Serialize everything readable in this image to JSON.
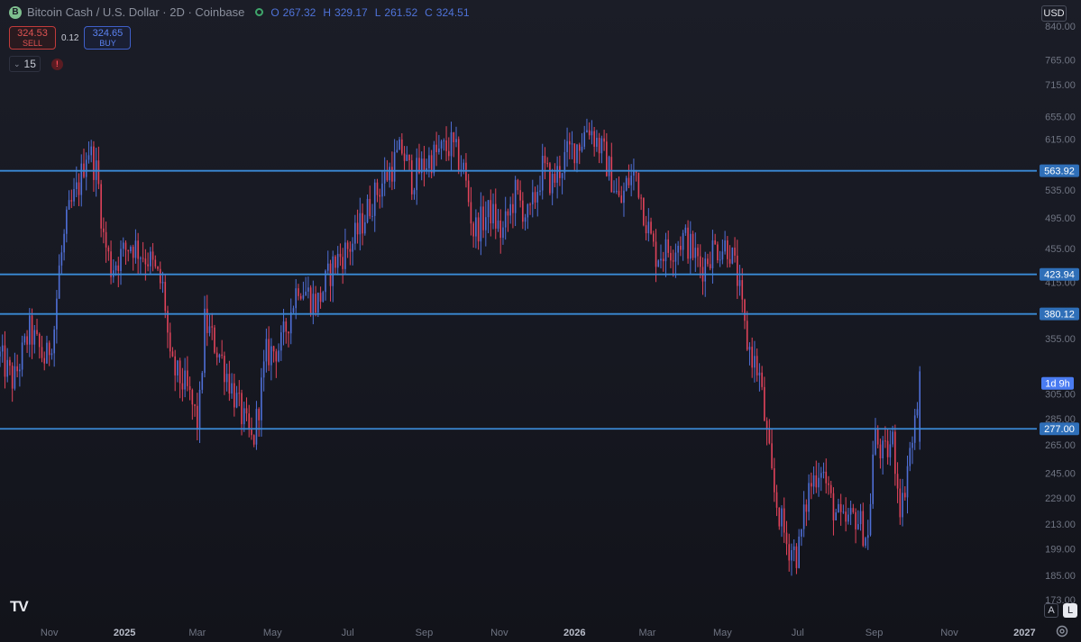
{
  "header": {
    "symbol_logo": "B",
    "title": "Bitcoin Cash / U.S. Dollar · 2D · Coinbase",
    "ohlc": [
      {
        "label": "O",
        "value": "267.32"
      },
      {
        "label": "H",
        "value": "329.17"
      },
      {
        "label": "L",
        "value": "261.52"
      },
      {
        "label": "C",
        "value": "324.51"
      }
    ]
  },
  "trade": {
    "sell_price": "324.53",
    "sell_label": "SELL",
    "spread": "0.12",
    "buy_price": "324.65",
    "buy_label": "BUY"
  },
  "indicators": {
    "count": "15",
    "alert_symbol": "!"
  },
  "currency": "USD",
  "logo_text": "TV",
  "scale_buttons": {
    "auto": "A",
    "log": "L"
  },
  "icons": {
    "settings": "gear-icon",
    "alert": "alert-icon",
    "collapse": "chevron-down-icon",
    "symbol": "bitcoin-cash-icon",
    "status": "market-status-icon"
  },
  "colors": {
    "up": "#4f6fd6",
    "down": "#e0435a",
    "level_line": "#3a8ad6",
    "level_label": "#2f6fb8",
    "countdown_label": "#4a7cf2"
  },
  "chart_data": {
    "type": "candlestick",
    "log_scale": true,
    "grid": false,
    "y_ticks": [
      840,
      765,
      715,
      655,
      615,
      535,
      495,
      455,
      415,
      355,
      305,
      285,
      265,
      245,
      229,
      213,
      199,
      185,
      173
    ],
    "x_ticks": [
      {
        "label": "Nov",
        "date": "2024-11-01"
      },
      {
        "label": "2025",
        "date": "2025-01-01"
      },
      {
        "label": "Mar",
        "date": "2025-03-01"
      },
      {
        "label": "May",
        "date": "2025-05-01"
      },
      {
        "label": "Jul",
        "date": "2025-07-01"
      },
      {
        "label": "Sep",
        "date": "2025-09-01"
      },
      {
        "label": "Nov",
        "date": "2025-11-01"
      },
      {
        "label": "2026",
        "date": "2026-01-01"
      },
      {
        "label": "Mar",
        "date": "2026-03-01"
      },
      {
        "label": "May",
        "date": "2026-05-01"
      },
      {
        "label": "Jul",
        "date": "2026-07-01"
      },
      {
        "label": "Sep",
        "date": "2026-09-01"
      },
      {
        "label": "Nov",
        "date": "2026-11-01"
      },
      {
        "label": "2027",
        "date": "2027-01-01"
      }
    ],
    "ylim": [
      163,
      885
    ],
    "xlim": [
      "2024-09-22",
      "2027-01-08"
    ],
    "levels": [
      {
        "value": 563.92,
        "label": "563.92"
      },
      {
        "value": 423.94,
        "label": "423.94"
      },
      {
        "value": 380.12,
        "label": "380.12"
      },
      {
        "value": 277.0,
        "label": "277.00"
      }
    ],
    "countdown": {
      "value": 314,
      "label": "1d 9h"
    },
    "price_path": [
      {
        "date": "2024-09-22",
        "price": 338
      },
      {
        "date": "2024-10-03",
        "price": 315
      },
      {
        "date": "2024-10-16",
        "price": 363
      },
      {
        "date": "2024-10-29",
        "price": 333
      },
      {
        "date": "2024-11-05",
        "price": 367
      },
      {
        "date": "2024-11-09",
        "price": 430
      },
      {
        "date": "2024-11-16",
        "price": 497
      },
      {
        "date": "2024-11-26",
        "price": 548
      },
      {
        "date": "2024-12-02",
        "price": 605
      },
      {
        "date": "2024-12-10",
        "price": 558
      },
      {
        "date": "2024-12-15",
        "price": 470
      },
      {
        "date": "2024-12-21",
        "price": 432
      },
      {
        "date": "2025-01-06",
        "price": 462
      },
      {
        "date": "2025-01-21",
        "price": 442
      },
      {
        "date": "2025-02-02",
        "price": 405
      },
      {
        "date": "2025-02-07",
        "price": 330
      },
      {
        "date": "2025-02-20",
        "price": 310
      },
      {
        "date": "2025-03-02",
        "price": 280
      },
      {
        "date": "2025-03-07",
        "price": 372
      },
      {
        "date": "2025-03-21",
        "price": 335
      },
      {
        "date": "2025-04-05",
        "price": 290
      },
      {
        "date": "2025-04-15",
        "price": 265
      },
      {
        "date": "2025-04-26",
        "price": 340
      },
      {
        "date": "2025-05-08",
        "price": 348
      },
      {
        "date": "2025-05-22",
        "price": 415
      },
      {
        "date": "2025-06-06",
        "price": 390
      },
      {
        "date": "2025-06-20",
        "price": 438
      },
      {
        "date": "2025-07-05",
        "price": 462
      },
      {
        "date": "2025-07-20",
        "price": 518
      },
      {
        "date": "2025-08-04",
        "price": 565
      },
      {
        "date": "2025-08-14",
        "price": 598
      },
      {
        "date": "2025-08-22",
        "price": 552
      },
      {
        "date": "2025-09-06",
        "price": 584
      },
      {
        "date": "2025-09-23",
        "price": 605
      },
      {
        "date": "2025-10-03",
        "price": 566
      },
      {
        "date": "2025-10-11",
        "price": 478
      },
      {
        "date": "2025-10-25",
        "price": 505
      },
      {
        "date": "2025-11-03",
        "price": 472
      },
      {
        "date": "2025-11-14",
        "price": 530
      },
      {
        "date": "2025-11-25",
        "price": 492
      },
      {
        "date": "2025-12-06",
        "price": 568
      },
      {
        "date": "2025-12-14",
        "price": 545
      },
      {
        "date": "2025-12-26",
        "price": 590
      },
      {
        "date": "2026-01-07",
        "price": 615
      },
      {
        "date": "2026-01-12",
        "price": 642
      },
      {
        "date": "2026-01-25",
        "price": 588
      },
      {
        "date": "2026-02-01",
        "price": 548
      },
      {
        "date": "2026-02-07",
        "price": 512
      },
      {
        "date": "2026-02-13",
        "price": 548
      },
      {
        "date": "2026-02-20",
        "price": 560
      },
      {
        "date": "2026-02-27",
        "price": 500
      },
      {
        "date": "2026-03-07",
        "price": 448
      },
      {
        "date": "2026-03-20",
        "price": 455
      },
      {
        "date": "2026-03-31",
        "price": 470
      },
      {
        "date": "2026-04-14",
        "price": 432
      },
      {
        "date": "2026-04-23",
        "price": 455
      },
      {
        "date": "2026-05-06",
        "price": 460
      },
      {
        "date": "2026-05-13",
        "price": 420
      },
      {
        "date": "2026-05-20",
        "price": 355
      },
      {
        "date": "2026-05-31",
        "price": 320
      },
      {
        "date": "2026-06-11",
        "price": 235
      },
      {
        "date": "2026-06-22",
        "price": 202
      },
      {
        "date": "2026-07-01",
        "price": 196
      },
      {
        "date": "2026-07-10",
        "price": 235
      },
      {
        "date": "2026-07-20",
        "price": 252
      },
      {
        "date": "2026-07-27",
        "price": 228
      },
      {
        "date": "2026-08-06",
        "price": 212
      },
      {
        "date": "2026-08-17",
        "price": 218
      },
      {
        "date": "2026-08-27",
        "price": 205
      },
      {
        "date": "2026-09-01",
        "price": 272
      },
      {
        "date": "2026-09-09",
        "price": 256
      },
      {
        "date": "2026-09-16",
        "price": 268
      },
      {
        "date": "2026-09-23",
        "price": 220
      },
      {
        "date": "2026-09-29",
        "price": 258
      },
      {
        "date": "2026-10-03",
        "price": 270
      },
      {
        "date": "2026-10-08",
        "price": 324
      }
    ]
  }
}
